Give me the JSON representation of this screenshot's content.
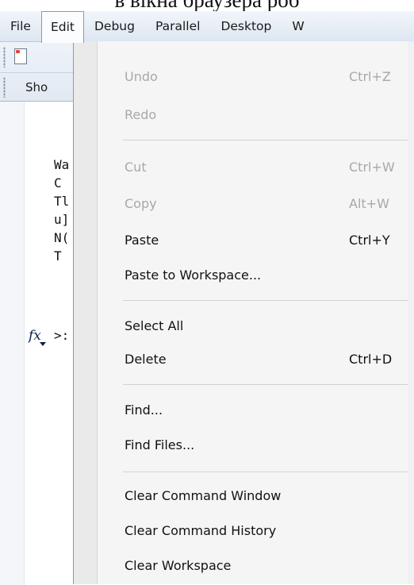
{
  "caption": "в вікна браузера роб",
  "menubar": {
    "items": [
      {
        "label": "File"
      },
      {
        "label": "Edit"
      },
      {
        "label": "Debug"
      },
      {
        "label": "Parallel"
      },
      {
        "label": "Desktop"
      },
      {
        "label": "W"
      }
    ]
  },
  "toolbar": {
    "shortcuts_label": "Sho"
  },
  "command_window": {
    "lines": [
      "Wa",
      "C",
      "Tl",
      "u]",
      "N(",
      "T"
    ],
    "prompt": ">:",
    "fx_label": "fx"
  },
  "edit_menu": {
    "groups": [
      [
        {
          "label": "Undo",
          "shortcut": "Ctrl+Z",
          "enabled": false
        },
        {
          "label": "Redo",
          "shortcut": "",
          "enabled": false
        }
      ],
      [
        {
          "label": "Cut",
          "shortcut": "Ctrl+W",
          "enabled": false
        },
        {
          "label": "Copy",
          "shortcut": "Alt+W",
          "enabled": false
        },
        {
          "label": "Paste",
          "shortcut": "Ctrl+Y",
          "enabled": true
        },
        {
          "label": "Paste to Workspace...",
          "shortcut": "",
          "enabled": true
        }
      ],
      [
        {
          "label": "Select All",
          "shortcut": "",
          "enabled": true
        },
        {
          "label": "Delete",
          "shortcut": "Ctrl+D",
          "enabled": true
        }
      ],
      [
        {
          "label": "Find...",
          "shortcut": "",
          "enabled": true
        },
        {
          "label": "Find Files...",
          "shortcut": "",
          "enabled": true
        }
      ],
      [
        {
          "label": "Clear Command Window",
          "shortcut": "",
          "enabled": true
        },
        {
          "label": "Clear Command History",
          "shortcut": "",
          "enabled": true
        },
        {
          "label": "Clear Workspace",
          "shortcut": "",
          "enabled": true
        }
      ]
    ]
  }
}
